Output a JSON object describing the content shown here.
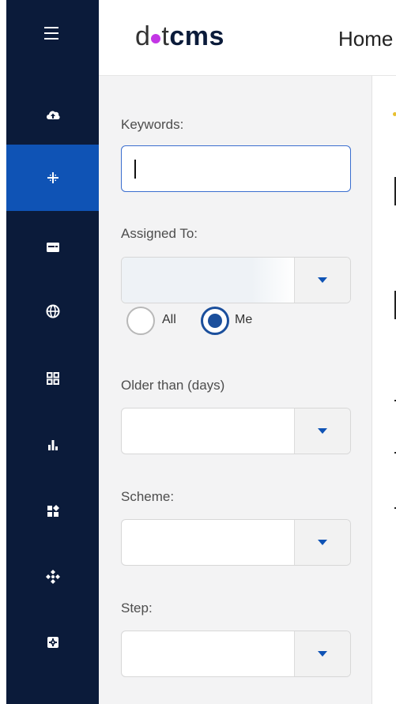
{
  "brand": {
    "logo_pre": "d",
    "logo_post": "t",
    "logo_bold": "cms",
    "accent_dot_color": "#c336e5",
    "sidebar_color": "#0b1b3a",
    "active_color": "#0f53b5"
  },
  "header": {
    "home_label": "Home"
  },
  "sidebar": {
    "items": [
      {
        "icon": "cloud-upload-icon",
        "active": false
      },
      {
        "icon": "grid-dots-icon",
        "active": true
      },
      {
        "icon": "window-icon",
        "active": false
      },
      {
        "icon": "globe-icon",
        "active": false
      },
      {
        "icon": "apps-grid-icon",
        "active": false
      },
      {
        "icon": "bar-chart-icon",
        "active": false
      },
      {
        "icon": "puzzle-icon",
        "active": false
      },
      {
        "icon": "diamond-cluster-icon",
        "active": false
      },
      {
        "icon": "gear-box-icon",
        "active": false
      }
    ]
  },
  "filters": {
    "keywords": {
      "label": "Keywords:",
      "value": ""
    },
    "assigned_to": {
      "label": "Assigned To:",
      "value": "",
      "radio_all": "All",
      "radio_me": "Me",
      "selected": "Me"
    },
    "older_than": {
      "label": "Older than (days)",
      "value": ""
    },
    "scheme": {
      "label": "Scheme:",
      "value": ""
    },
    "step": {
      "label": "Step:",
      "value": ""
    }
  }
}
